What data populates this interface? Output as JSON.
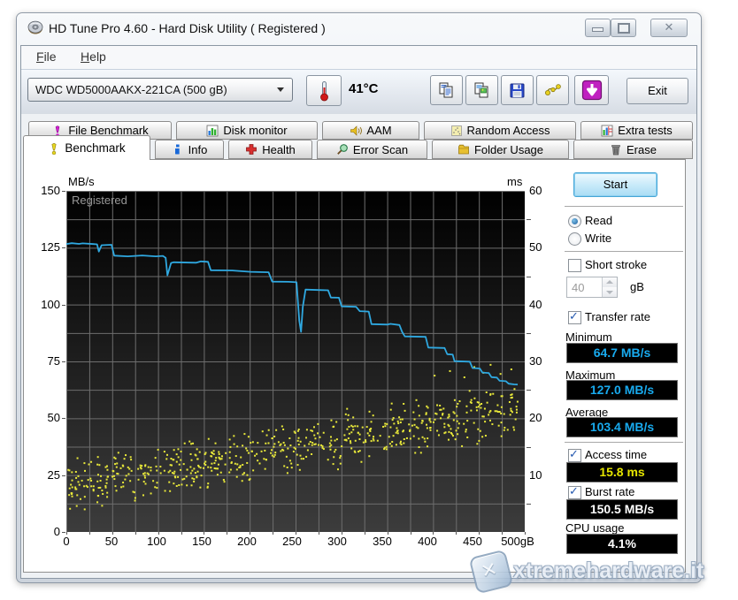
{
  "window": {
    "title": "HD Tune Pro 4.60 - Hard Disk Utility (  Registered )",
    "app_icon": "hd-tune-disk-icon",
    "controls": [
      "minimize",
      "maximize",
      "close"
    ]
  },
  "menu": {
    "items": [
      {
        "label": "File"
      },
      {
        "label": "Help"
      }
    ]
  },
  "toolbar": {
    "drive_select": {
      "value": "WDC WD5000AAKX-221CA    (500 gB)"
    },
    "temperature_button_icon": "thermometer-icon",
    "temperature": "41°C",
    "buttons": [
      "copy-text-icon",
      "copy-image-icon",
      "save-icon",
      "device-icon",
      "download-icon"
    ],
    "exit_label": "Exit"
  },
  "tabs": {
    "row1": [
      {
        "label": "File Benchmark",
        "icon": "file-benchmark-icon"
      },
      {
        "label": "Disk monitor",
        "icon": "disk-monitor-icon"
      },
      {
        "label": "AAM",
        "icon": "aam-icon"
      },
      {
        "label": "Random Access",
        "icon": "random-access-icon"
      },
      {
        "label": "Extra tests",
        "icon": "extra-tests-icon"
      }
    ],
    "row2": [
      {
        "label": "Benchmark",
        "icon": "benchmark-icon",
        "active": true
      },
      {
        "label": "Info",
        "icon": "info-icon"
      },
      {
        "label": "Health",
        "icon": "health-icon"
      },
      {
        "label": "Error Scan",
        "icon": "error-scan-icon"
      },
      {
        "label": "Folder Usage",
        "icon": "folder-usage-icon"
      },
      {
        "label": "Erase",
        "icon": "erase-icon"
      }
    ]
  },
  "benchmark_panel": {
    "start_label": "Start",
    "read_label": "Read",
    "write_label": "Write",
    "read_selected": true,
    "short_stroke_label": "Short stroke",
    "short_stroke_checked": false,
    "capacity_value": "40",
    "capacity_unit": "gB",
    "transfer_rate_label": "Transfer rate",
    "transfer_rate_checked": true,
    "minimum_label": "Minimum",
    "minimum_value": "64.7 MB/s",
    "maximum_label": "Maximum",
    "maximum_value": "127.0 MB/s",
    "average_label": "Average",
    "average_value": "103.4 MB/s",
    "access_time_label": "Access time",
    "access_time_checked": true,
    "access_time_value": "15.8 ms",
    "burst_rate_label": "Burst rate",
    "burst_rate_checked": true,
    "burst_rate_value": "150.5 MB/s",
    "cpu_usage_label": "CPU usage",
    "cpu_usage_value": "4.1%"
  },
  "chart_data": {
    "type": "line",
    "watermark": "Registered",
    "grid": true,
    "plot_bg": [
      "#000000",
      "#3c3c3c"
    ],
    "left_axis": {
      "label": "MB/s",
      "range": [
        0,
        150
      ],
      "ticks": [
        150,
        125,
        100,
        75,
        50,
        25,
        0
      ]
    },
    "right_axis": {
      "label": "ms",
      "range": [
        0,
        60
      ],
      "ticks": [
        60,
        50,
        40,
        30,
        20,
        10
      ]
    },
    "x_axis": {
      "range": [
        0,
        500
      ],
      "unit": "gB",
      "tick_labels": [
        "0",
        "50",
        "100",
        "150",
        "200",
        "250",
        "300",
        "350",
        "400",
        "450",
        "500gB"
      ],
      "tick_values": [
        0,
        50,
        100,
        150,
        200,
        250,
        300,
        350,
        400,
        450,
        500
      ]
    },
    "series": [
      {
        "name": "transfer_rate",
        "type": "line",
        "color": "#2fa8e0",
        "unit": "MB/s",
        "axis": "left",
        "points": [
          [
            0,
            126.6
          ],
          [
            6,
            127.0
          ],
          [
            14,
            126.7
          ],
          [
            18,
            126.9
          ],
          [
            30,
            126.6
          ],
          [
            34,
            126.5
          ],
          [
            36,
            123.3
          ],
          [
            39,
            126.1
          ],
          [
            50,
            126.3
          ],
          [
            53,
            121.5
          ],
          [
            68,
            121.2
          ],
          [
            84,
            121.6
          ],
          [
            99,
            121.2
          ],
          [
            107,
            121.4
          ],
          [
            110,
            120.6
          ],
          [
            112,
            112.9
          ],
          [
            116,
            118.3
          ],
          [
            119,
            118.6
          ],
          [
            144,
            118.4
          ],
          [
            149,
            119.0
          ],
          [
            157,
            118.8
          ],
          [
            160,
            115.1
          ],
          [
            184,
            115.0
          ],
          [
            204,
            114.4
          ],
          [
            224,
            114.2
          ],
          [
            228,
            110.1
          ],
          [
            246,
            110.0
          ],
          [
            255,
            109.8
          ],
          [
            258,
            93.0
          ],
          [
            260,
            88.0
          ],
          [
            262,
            99.0
          ],
          [
            265,
            106.6
          ],
          [
            279,
            106.4
          ],
          [
            290,
            106.3
          ],
          [
            293,
            103.1
          ],
          [
            302,
            103.0
          ],
          [
            305,
            99.2
          ],
          [
            321,
            99.0
          ],
          [
            325,
            97.1
          ],
          [
            335,
            96.9
          ],
          [
            338,
            91.4
          ],
          [
            356,
            91.2
          ],
          [
            359,
            91.5
          ],
          [
            369,
            91.0
          ],
          [
            372,
            88.0
          ],
          [
            375,
            86.0
          ],
          [
            398,
            85.8
          ],
          [
            401,
            81.1
          ],
          [
            419,
            80.9
          ],
          [
            422,
            78.2
          ],
          [
            428,
            78.0
          ],
          [
            430,
            75.1
          ],
          [
            447,
            74.9
          ],
          [
            450,
            72.1
          ],
          [
            458,
            71.9
          ],
          [
            461,
            70.1
          ],
          [
            468,
            69.9
          ],
          [
            471,
            68.1
          ],
          [
            477,
            67.9
          ],
          [
            480,
            66.5
          ],
          [
            487,
            66.3
          ],
          [
            490,
            65.2
          ],
          [
            496,
            64.9
          ],
          [
            500,
            64.8
          ]
        ]
      },
      {
        "name": "access_time",
        "type": "scatter",
        "color": "#e8e83a",
        "unit": "ms",
        "axis": "right",
        "generated": {
          "seed": 20140607,
          "count": 650,
          "ms_band_at_0_gB": [
            3.0,
            13.3
          ],
          "ms_band_at_500_gB": [
            16.2,
            26.5
          ],
          "trend": "rising"
        },
        "outliers_ms": [
          [
            408,
            27.5
          ],
          [
            425,
            28.3
          ],
          [
            441,
            27.2
          ],
          [
            452,
            29.0
          ],
          [
            462,
            28.0
          ],
          [
            470,
            29.4
          ],
          [
            481,
            27.8
          ],
          [
            493,
            28.6
          ]
        ]
      }
    ],
    "stats": {
      "minimum_mbs": 64.7,
      "maximum_mbs": 127.0,
      "average_mbs": 103.4,
      "access_time_ms": 15.8,
      "burst_rate_mbs": 150.5,
      "cpu_usage_pct": 4.1
    }
  },
  "watermark": {
    "text": "xtremehardware.it",
    "logo": "xtremehardware-logo"
  }
}
